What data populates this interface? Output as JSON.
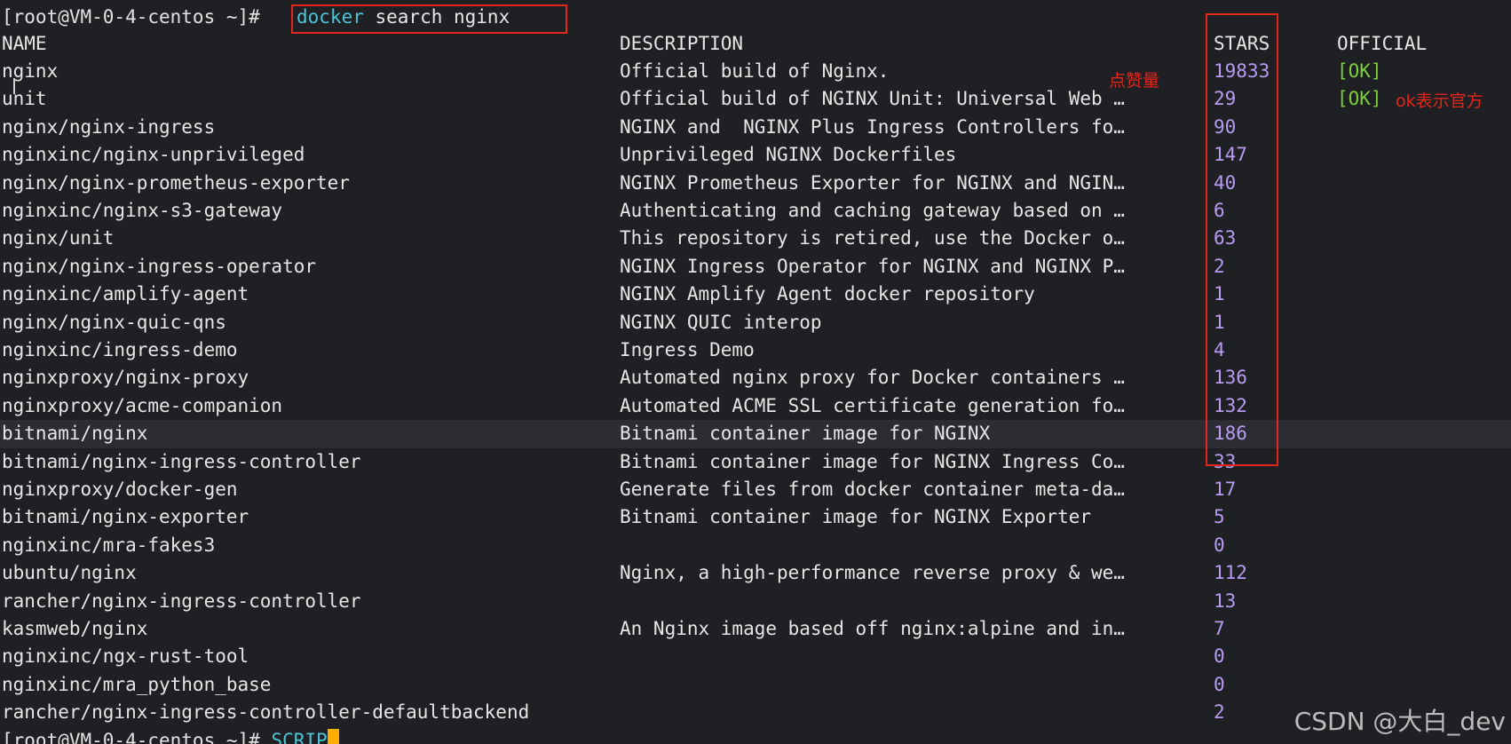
{
  "prompt": {
    "text": "[root@VM-0-4-centos ~]#",
    "command_bin": "docker",
    "command_args": " search nginx"
  },
  "headers": {
    "name": "NAME",
    "description": "DESCRIPTION",
    "stars": "STARS",
    "official": "OFFICIAL"
  },
  "rows": [
    {
      "name": "nginx",
      "description": "Official build of Nginx.",
      "stars": "19833",
      "official": "[OK]"
    },
    {
      "name": "unit",
      "description": "Official build of NGINX Unit: Universal Web …",
      "stars": "29",
      "official": "[OK]"
    },
    {
      "name": "nginx/nginx-ingress",
      "description": "NGINX and  NGINX Plus Ingress Controllers fo…",
      "stars": "90",
      "official": ""
    },
    {
      "name": "nginxinc/nginx-unprivileged",
      "description": "Unprivileged NGINX Dockerfiles",
      "stars": "147",
      "official": ""
    },
    {
      "name": "nginx/nginx-prometheus-exporter",
      "description": "NGINX Prometheus Exporter for NGINX and NGIN…",
      "stars": "40",
      "official": ""
    },
    {
      "name": "nginxinc/nginx-s3-gateway",
      "description": "Authenticating and caching gateway based on …",
      "stars": "6",
      "official": ""
    },
    {
      "name": "nginx/unit",
      "description": "This repository is retired, use the Docker o…",
      "stars": "63",
      "official": ""
    },
    {
      "name": "nginx/nginx-ingress-operator",
      "description": "NGINX Ingress Operator for NGINX and NGINX P…",
      "stars": "2",
      "official": ""
    },
    {
      "name": "nginxinc/amplify-agent",
      "description": "NGINX Amplify Agent docker repository",
      "stars": "1",
      "official": ""
    },
    {
      "name": "nginx/nginx-quic-qns",
      "description": "NGINX QUIC interop",
      "stars": "1",
      "official": ""
    },
    {
      "name": "nginxinc/ingress-demo",
      "description": "Ingress Demo",
      "stars": "4",
      "official": ""
    },
    {
      "name": "nginxproxy/nginx-proxy",
      "description": "Automated nginx proxy for Docker containers …",
      "stars": "136",
      "official": ""
    },
    {
      "name": "nginxproxy/acme-companion",
      "description": "Automated ACME SSL certificate generation fo…",
      "stars": "132",
      "official": ""
    },
    {
      "name": "bitnami/nginx",
      "description": "Bitnami container image for NGINX",
      "stars": "186",
      "official": ""
    },
    {
      "name": "bitnami/nginx-ingress-controller",
      "description": "Bitnami container image for NGINX Ingress Co…",
      "stars": "33",
      "official": ""
    },
    {
      "name": "nginxproxy/docker-gen",
      "description": "Generate files from docker container meta-da…",
      "stars": "17",
      "official": ""
    },
    {
      "name": "bitnami/nginx-exporter",
      "description": "Bitnami container image for NGINX Exporter",
      "stars": "5",
      "official": ""
    },
    {
      "name": "nginxinc/mra-fakes3",
      "description": "",
      "stars": "0",
      "official": ""
    },
    {
      "name": "ubuntu/nginx",
      "description": "Nginx, a high-performance reverse proxy & we…",
      "stars": "112",
      "official": ""
    },
    {
      "name": "rancher/nginx-ingress-controller",
      "description": "",
      "stars": "13",
      "official": ""
    },
    {
      "name": "kasmweb/nginx",
      "description": "An Nginx image based off nginx:alpine and in…",
      "stars": "7",
      "official": ""
    },
    {
      "name": "nginxinc/ngx-rust-tool",
      "description": "",
      "stars": "0",
      "official": ""
    },
    {
      "name": "nginxinc/mra_python_base",
      "description": "",
      "stars": "0",
      "official": ""
    },
    {
      "name": "rancher/nginx-ingress-controller-defaultbackend",
      "description": "",
      "stars": "2",
      "official": ""
    }
  ],
  "final_prompt": {
    "text": "[root@VM-0-4-centos ~]#",
    "typed": " SCRIP"
  },
  "annotations": {
    "stars_label": "点赞量",
    "official_label": "ok表示官方"
  },
  "watermark": "CSDN @大白_dev",
  "colors": {
    "stars": "#b79cf2",
    "official_ok": "#7ccf3a",
    "command": "#4cc4d6",
    "annotation": "#e2261c",
    "cursor": "#ffae00"
  }
}
